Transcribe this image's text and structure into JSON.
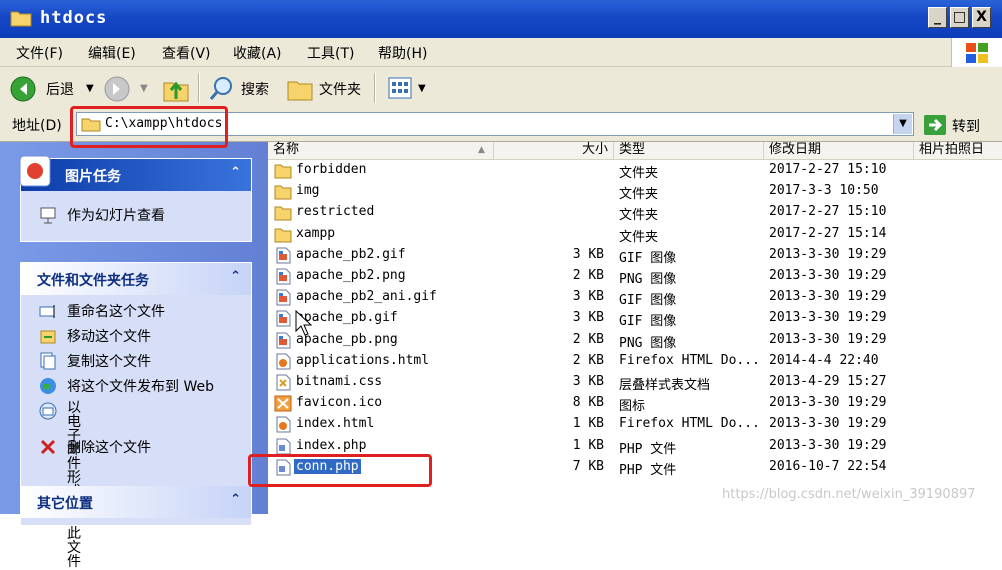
{
  "window": {
    "title": "htdocs"
  },
  "window_buttons": {
    "minimize": "_",
    "maximize": "□",
    "close": "X"
  },
  "menu": [
    "文件(F)",
    "编辑(E)",
    "查看(V)",
    "收藏(A)",
    "工具(T)",
    "帮助(H)"
  ],
  "toolbar": {
    "back": "后退",
    "search": "搜索",
    "folders": "文件夹"
  },
  "address": {
    "label": "地址(D)",
    "path": "C:\\xampp\\htdocs",
    "go": "转到"
  },
  "tasks": {
    "picture": {
      "title": "图片任务",
      "items": [
        "作为幻灯片查看"
      ]
    },
    "file": {
      "title": "文件和文件夹任务",
      "items": [
        "重命名这个文件",
        "移动这个文件",
        "复制这个文件",
        "将这个文件发布到 Web",
        "以电子邮件形式发送此\n文件",
        "删除这个文件"
      ]
    },
    "other": {
      "title": "其它位置"
    }
  },
  "columns": {
    "name": "名称",
    "size": "大小",
    "type": "类型",
    "modified": "修改日期",
    "photo_date": "相片拍照日"
  },
  "files": [
    {
      "name": "forbidden",
      "size": "",
      "type": "文件夹",
      "modified": "2017-2-27 15:10",
      "icon": "folder"
    },
    {
      "name": "img",
      "size": "",
      "type": "文件夹",
      "modified": "2017-3-3 10:50",
      "icon": "folder"
    },
    {
      "name": "restricted",
      "size": "",
      "type": "文件夹",
      "modified": "2017-2-27 15:10",
      "icon": "folder"
    },
    {
      "name": "xampp",
      "size": "",
      "type": "文件夹",
      "modified": "2017-2-27 15:14",
      "icon": "folder"
    },
    {
      "name": "apache_pb2.gif",
      "size": "3 KB",
      "type": "GIF 图像",
      "modified": "2013-3-30 19:29",
      "icon": "image"
    },
    {
      "name": "apache_pb2.png",
      "size": "2 KB",
      "type": "PNG 图像",
      "modified": "2013-3-30 19:29",
      "icon": "image"
    },
    {
      "name": "apache_pb2_ani.gif",
      "size": "3 KB",
      "type": "GIF 图像",
      "modified": "2013-3-30 19:29",
      "icon": "image"
    },
    {
      "name": "apache_pb.gif",
      "size": "3 KB",
      "type": "GIF 图像",
      "modified": "2013-3-30 19:29",
      "icon": "image"
    },
    {
      "name": "apache_pb.png",
      "size": "2 KB",
      "type": "PNG 图像",
      "modified": "2013-3-30 19:29",
      "icon": "image"
    },
    {
      "name": "applications.html",
      "size": "2 KB",
      "type": "Firefox HTML Do...",
      "modified": "2014-4-4 22:40",
      "icon": "html"
    },
    {
      "name": "bitnami.css",
      "size": "3 KB",
      "type": "层叠样式表文档",
      "modified": "2013-4-29 15:27",
      "icon": "css"
    },
    {
      "name": "favicon.ico",
      "size": "8 KB",
      "type": "图标",
      "modified": "2013-3-30 19:29",
      "icon": "ico"
    },
    {
      "name": "index.html",
      "size": "1 KB",
      "type": "Firefox HTML Do...",
      "modified": "2013-3-30 19:29",
      "icon": "html"
    },
    {
      "name": "index.php",
      "size": "1 KB",
      "type": "PHP 文件",
      "modified": "2013-3-30 19:29",
      "icon": "php"
    },
    {
      "name": "conn.php",
      "size": "7 KB",
      "type": "PHP 文件",
      "modified": "2016-10-7 22:54",
      "icon": "php",
      "selected": true
    }
  ],
  "watermark": "https://blog.csdn.net/weixin_39190897"
}
